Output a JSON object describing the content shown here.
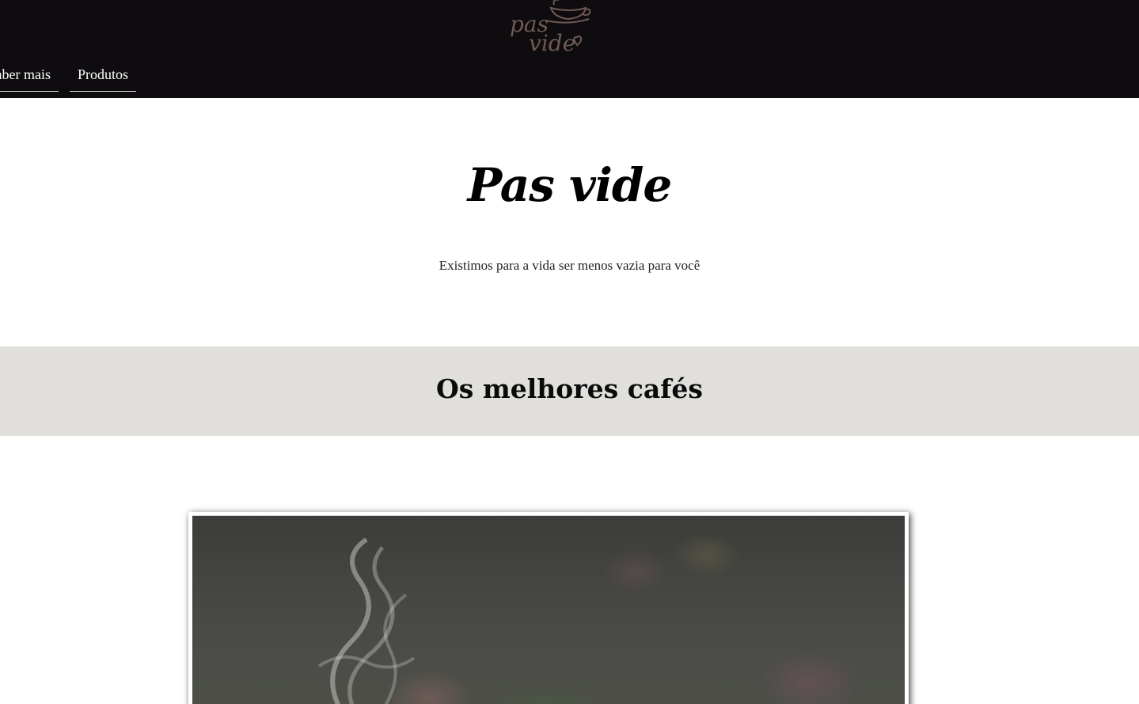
{
  "header": {
    "logo": {
      "line1": "pas",
      "line2": "vide",
      "icon": "coffee-cup-icon",
      "color": "#6e5a52"
    },
    "background": "#0e0c0f",
    "nav": [
      {
        "label": "Saber mais"
      },
      {
        "label": "Produtos"
      }
    ]
  },
  "hero": {
    "title": "Pas vide",
    "subtitle": "Existimos para a vida ser menos vazia para você"
  },
  "band": {
    "title": "Os melhores cafés",
    "background": "#e0dfdc"
  },
  "photo": {
    "description_icon": "coffee-steam-image"
  }
}
